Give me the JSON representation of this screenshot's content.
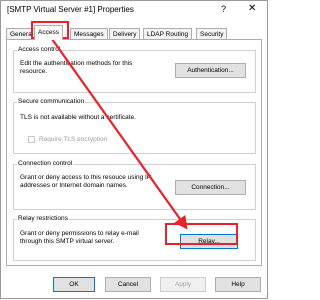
{
  "window": {
    "title": "[SMTP Virtual Server #1] Properties",
    "help_glyph": "?",
    "close_glyph": "✕"
  },
  "tabs": [
    {
      "label": "General",
      "active": false
    },
    {
      "label": "Access",
      "active": true
    },
    {
      "label": "Messages",
      "active": false
    },
    {
      "label": "Delivery",
      "active": false
    },
    {
      "label": "LDAP Routing",
      "active": false
    },
    {
      "label": "Security",
      "active": false
    }
  ],
  "access_control": {
    "title": "Access control",
    "text": "Edit the authentication methods for this resource.",
    "button": "Authentication..."
  },
  "secure_communication": {
    "title": "Secure communication",
    "text": "TLS is not available without a certificate.",
    "checkbox_label": "Require TLS encryption",
    "checkbox_checked": false
  },
  "connection_control": {
    "title": "Connection control",
    "text": "Grant or deny access to this resouce using IP addresses or Internet domain names.",
    "button": "Connection..."
  },
  "relay_restrictions": {
    "title": "Relay restrictions",
    "text": "Grant or deny permissions to relay e-mail through this SMTP virtual server.",
    "button": "Relay..."
  },
  "footer": {
    "ok": "OK",
    "cancel": "Cancel",
    "apply": "Apply",
    "help": "Help"
  },
  "annotation_color": "#e8212a"
}
